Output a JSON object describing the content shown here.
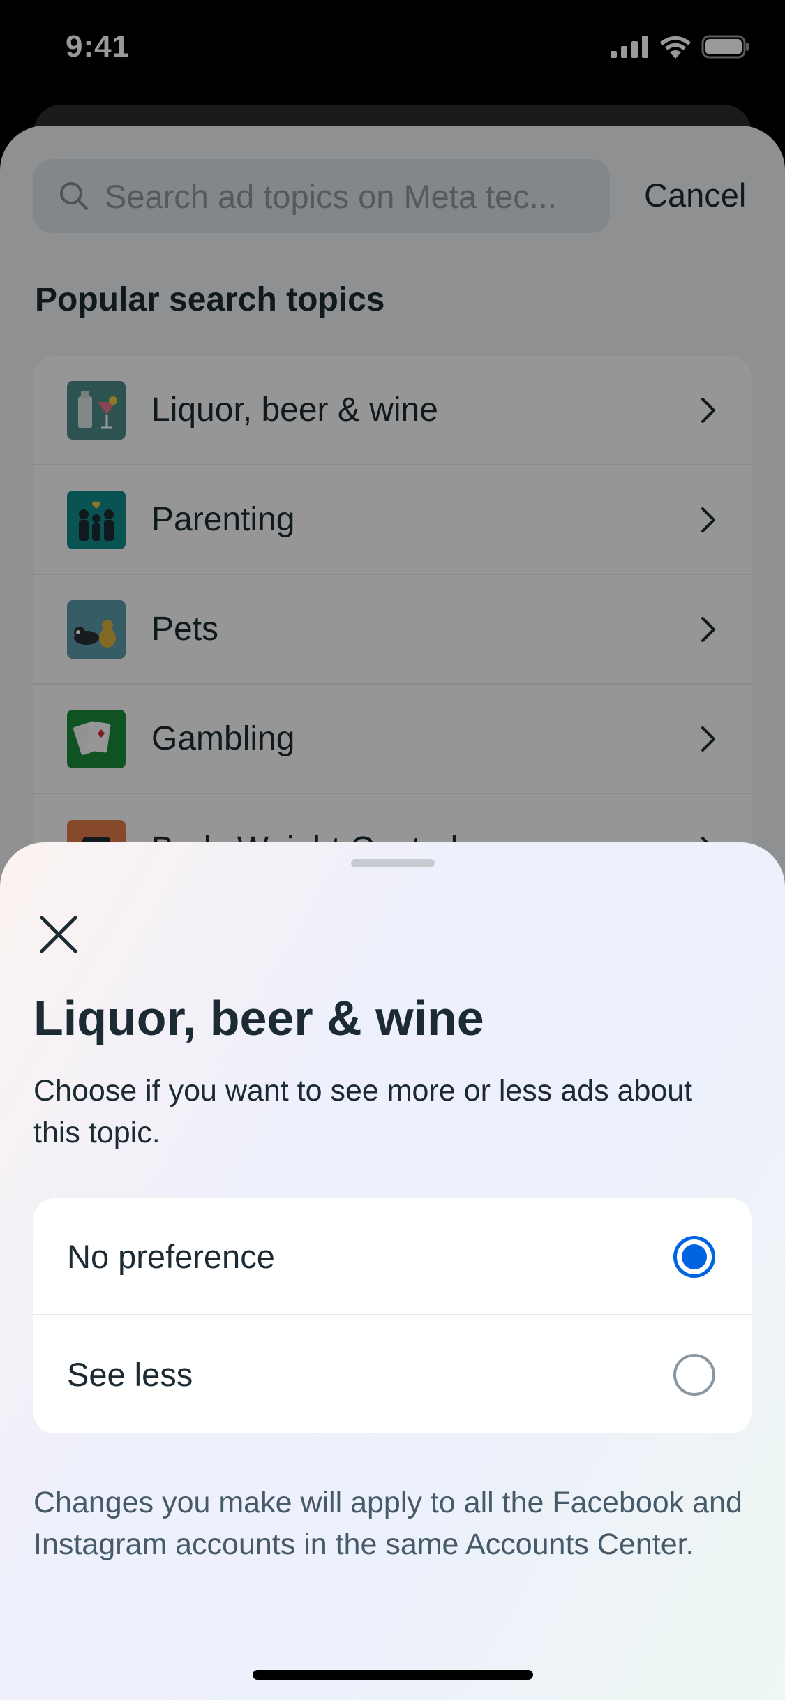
{
  "status_bar": {
    "time": "9:41"
  },
  "search": {
    "placeholder": "Search ad topics on Meta tec...",
    "cancel_label": "Cancel"
  },
  "popular": {
    "title": "Popular search topics",
    "topics": [
      {
        "label": "Liquor, beer & wine",
        "icon": "cocktail-icon"
      },
      {
        "label": "Parenting",
        "icon": "family-icon"
      },
      {
        "label": "Pets",
        "icon": "pets-icon"
      },
      {
        "label": "Gambling",
        "icon": "cards-icon"
      },
      {
        "label": "Body Weight Control",
        "icon": "scale-icon"
      }
    ]
  },
  "modal": {
    "title": "Liquor, beer & wine",
    "description": "Choose if you want to see more or less ads about this topic.",
    "options": [
      {
        "label": "No preference",
        "selected": true
      },
      {
        "label": "See less",
        "selected": false
      }
    ],
    "footer": "Changes you make will apply to all the Facebook and Instagram accounts in the same Accounts Center."
  },
  "colors": {
    "accent": "#0064e0",
    "text": "#1c2b33",
    "secondary_text": "#465a69"
  }
}
